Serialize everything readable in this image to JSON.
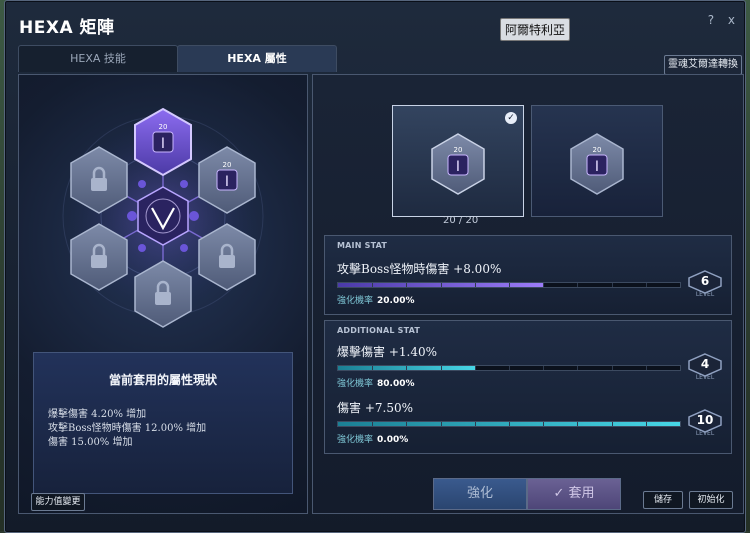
{
  "window": {
    "title": "HEXA 矩陣",
    "help_icon": "?",
    "close_icon": "x"
  },
  "tooltip": {
    "text": "阿爾特利亞"
  },
  "tabs": [
    {
      "label": "HEXA 技能",
      "active": false
    },
    {
      "label": "HEXA 屬性",
      "active": true
    }
  ],
  "soul_button": "靈魂艾爾達轉換",
  "matrix": {
    "slots": [
      {
        "state": "active",
        "level": "20"
      },
      {
        "state": "unlocked",
        "level": "20"
      },
      {
        "state": "locked"
      },
      {
        "state": "locked"
      },
      {
        "state": "locked"
      },
      {
        "state": "locked"
      }
    ]
  },
  "status": {
    "title": "當前套用的屬性現狀",
    "lines": [
      "爆擊傷害 4.20% 增加",
      "攻擊Boss怪物時傷害 12.00% 增加",
      "傷害 15.00% 增加"
    ]
  },
  "stat_change_button": "能力值變更",
  "cards": [
    {
      "level": "20",
      "selected": true
    },
    {
      "level": "20",
      "selected": false
    }
  ],
  "card_count": "20 / 20",
  "main_stat": {
    "header": "MAIN STAT",
    "name": "攻擊Boss怪物時傷害 +8.00%",
    "rate_label": "強化機率",
    "rate_value": "20.00%",
    "level": "6",
    "level_label": "LEVEL",
    "progress": 0.6
  },
  "additional_stat": {
    "header": "ADDITIONAL STAT",
    "items": [
      {
        "name": "爆擊傷害 +1.40%",
        "rate_label": "強化機率",
        "rate_value": "80.00%",
        "level": "4",
        "level_label": "LEVEL",
        "progress": 0.4
      },
      {
        "name": "傷害 +7.50%",
        "rate_label": "強化機率",
        "rate_value": "0.00%",
        "level": "10",
        "level_label": "LEVEL",
        "progress": 1.0
      }
    ]
  },
  "buttons": {
    "upgrade": "強化",
    "apply": "套用",
    "save": "儲存",
    "reset": "初始化"
  },
  "colors": {
    "main_bar": "#7a55e0",
    "add_bar": "#2bb8c8",
    "accent": "#b08cff"
  }
}
